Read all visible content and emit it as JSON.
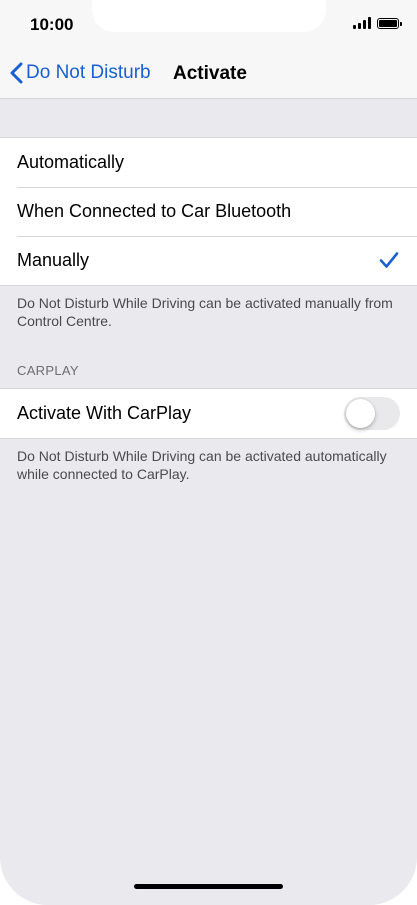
{
  "status_bar": {
    "time": "10:00",
    "signal_icon": "cellular-signal-icon",
    "battery_icon": "battery-icon"
  },
  "nav": {
    "back_label": "Do Not Disturb",
    "back_icon": "chevron-left-icon",
    "title": "Activate"
  },
  "activation_options": {
    "items": [
      {
        "label": "Automatically",
        "selected": false
      },
      {
        "label": "When Connected to Car Bluetooth",
        "selected": false
      },
      {
        "label": "Manually",
        "selected": true
      }
    ],
    "footer": "Do Not Disturb While Driving can be activated manually from Control Centre."
  },
  "carplay": {
    "header": "CARPLAY",
    "toggle_label": "Activate With CarPlay",
    "toggle_on": false,
    "footer": "Do Not Disturb While Driving can be activated automatically while connected to CarPlay."
  },
  "colors": {
    "accent": "#1a5fd1",
    "background": "#e9e9ee",
    "cell": "#ffffff"
  }
}
